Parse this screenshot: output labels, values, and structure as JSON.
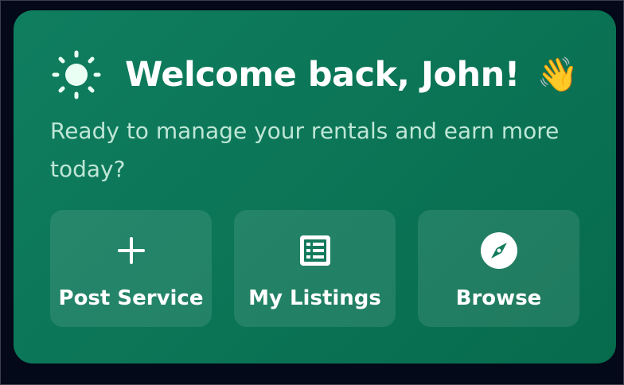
{
  "card": {
    "title": "Welcome back, John!",
    "title_emoji": "👋",
    "title_icon": "sun-icon",
    "subtitle": "Ready to manage your rentals and earn more today?"
  },
  "actions": [
    {
      "label": "Post Service",
      "icon": "plus-icon"
    },
    {
      "label": "My Listings",
      "icon": "list-icon"
    },
    {
      "label": "Browse",
      "icon": "compass-icon"
    }
  ],
  "colors": {
    "card_gradient_start": "#0f7e5f",
    "card_gradient_end": "#066b4c",
    "title": "#ffffff",
    "subtitle": "#bfe6d6",
    "page_background": "#04091a"
  }
}
